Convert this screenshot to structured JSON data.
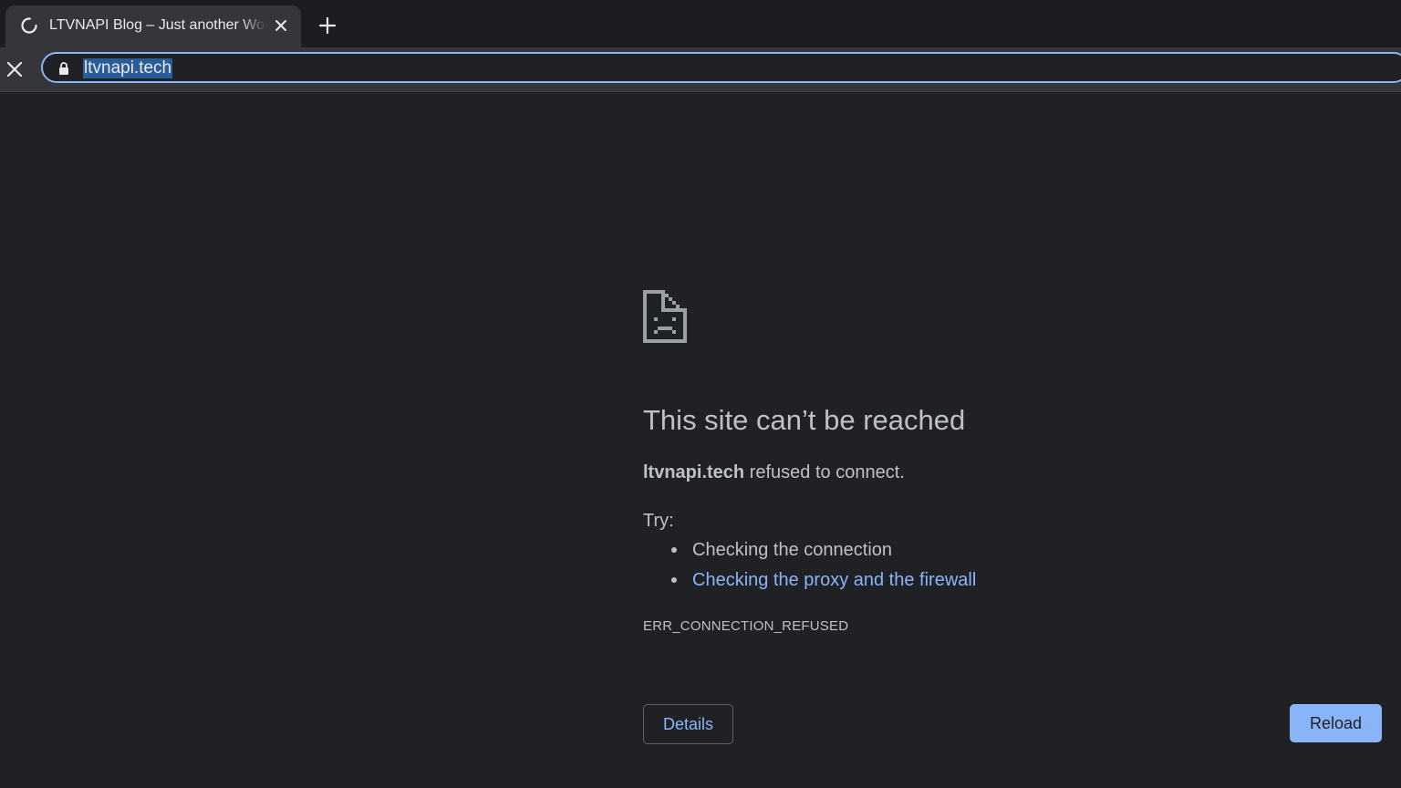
{
  "browser": {
    "tab": {
      "title": "LTVNAPI Blog – Just another WordPress site",
      "status_icon": "loading-spinner-icon",
      "close_icon": "close-icon"
    },
    "new_tab_icon": "plus-icon",
    "toolbar": {
      "stop_icon": "close-icon",
      "lock_icon": "lock-icon",
      "url": "ltvnapi.tech"
    }
  },
  "error_page": {
    "icon": "sad-page-icon",
    "title": "This site can’t be reached",
    "host": "ltvnapi.tech",
    "message": " refused to connect.",
    "try_label": "Try:",
    "suggestions": [
      {
        "text": "Checking the connection",
        "is_link": false
      },
      {
        "text": "Checking the proxy and the firewall",
        "is_link": true
      }
    ],
    "error_code": "ERR_CONNECTION_REFUSED",
    "details_button": "Details",
    "reload_button": "Reload"
  },
  "colors": {
    "background": "#202124",
    "text": "#bdc1c6",
    "link": "#8ab4f8",
    "accent": "#8ab4f8"
  }
}
